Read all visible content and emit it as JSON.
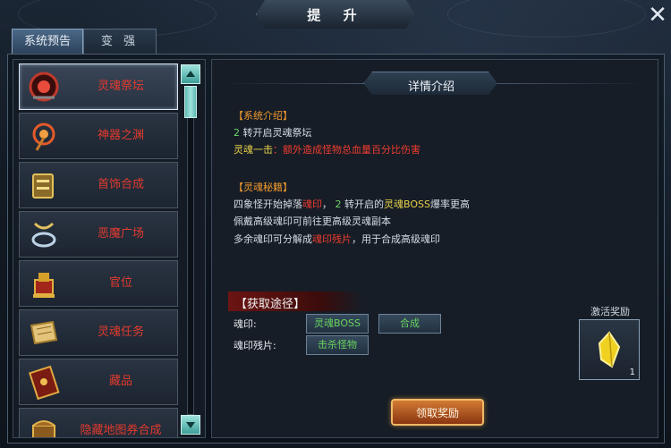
{
  "window": {
    "title": "提 升"
  },
  "tabs": [
    {
      "label": "系统预告",
      "active": true
    },
    {
      "label": "变 强",
      "active": false
    }
  ],
  "sidebar": {
    "items": [
      {
        "label": "灵魂祭坛",
        "icon": "altar-icon",
        "selected": true
      },
      {
        "label": "神器之渊",
        "icon": "artifact-icon"
      },
      {
        "label": "首饰合成",
        "icon": "jewelry-icon"
      },
      {
        "label": "恶魔广场",
        "icon": "ring-icon"
      },
      {
        "label": "官位",
        "icon": "seal-icon"
      },
      {
        "label": "灵魂任务",
        "icon": "scroll-icon"
      },
      {
        "label": "藏品",
        "icon": "book-icon"
      },
      {
        "label": "隐藏地图券合成",
        "icon": "chest-icon"
      }
    ]
  },
  "detail": {
    "header": "详情介绍",
    "intro_heading": "【系统介绍】",
    "intro_num": "2",
    "intro_text": " 转开启灵魂祭坛",
    "skill_name": "灵魂一击",
    "skill_desc": "：额外造成怪物总血量百分比伤害",
    "secret_heading": "【灵魂秘籍】",
    "secret_l1_a": "四象怪开始掉落",
    "secret_l1_b": "魂印",
    "secret_l1_c": "， ",
    "secret_l1_d": "2",
    "secret_l1_e": " 转开启的",
    "secret_l1_f": "灵魂BOSS",
    "secret_l1_g": "爆率更高",
    "secret_l2": "佩戴高级魂印可前往更高级灵魂副本",
    "secret_l3_a": "多余魂印可分解成",
    "secret_l3_b": "魂印残片",
    "secret_l3_c": "，用于合成高级魂印"
  },
  "acquire": {
    "heading": "【获取途径】",
    "rows": [
      {
        "label": "魂印:",
        "buttons": [
          "灵魂BOSS",
          "合成"
        ]
      },
      {
        "label": "魂印残片:",
        "buttons": [
          "击杀怪物"
        ]
      }
    ]
  },
  "reward": {
    "label": "激活奖励",
    "count": "1",
    "icon": "gold-crystal-icon"
  },
  "claim_button": "领取奖励",
  "colors": {
    "item_label": "#e23b2e",
    "heading_orange": "#f29a2e",
    "source_green": "#67d35e"
  }
}
